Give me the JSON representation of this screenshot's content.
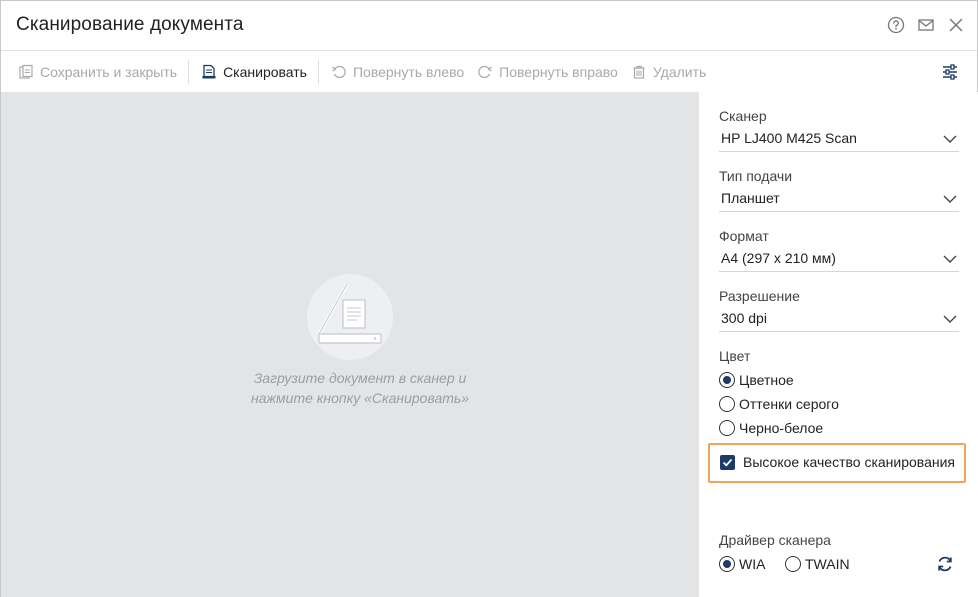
{
  "window": {
    "title": "Сканирование документа"
  },
  "title_icons": [
    "help-icon",
    "mail-icon",
    "close-icon"
  ],
  "toolbar": {
    "save_close": "Сохранить и закрыть",
    "scan": "Сканировать",
    "rotate_left": "Повернуть влево",
    "rotate_right": "Повернуть вправо",
    "delete": "Удалить"
  },
  "preview": {
    "hint_line1": "Загрузите документ в сканер и",
    "hint_line2": "нажмите кнопку «Сканировать»"
  },
  "settings": {
    "scanner": {
      "label": "Сканер",
      "value": "HP LJ400 M425 Scan"
    },
    "feed": {
      "label": "Тип подачи",
      "value": "Планшет"
    },
    "format": {
      "label": "Формат",
      "value": "А4 (297 x 210 мм)"
    },
    "resolution": {
      "label": "Разрешение",
      "value": "300 dpi"
    },
    "color": {
      "label": "Цвет",
      "options": [
        "Цветное",
        "Оттенки серого",
        "Черно-белое"
      ],
      "selected": "Цветное"
    },
    "high_quality": {
      "label": "Высокое качество сканирования",
      "checked": true
    },
    "driver": {
      "label": "Драйвер сканера",
      "options": [
        "WIA",
        "TWAIN"
      ],
      "selected": "WIA"
    }
  },
  "colors": {
    "accent": "#1e3a66",
    "highlight": "#f0a55a",
    "preview_bg": "#e3e4e6"
  }
}
